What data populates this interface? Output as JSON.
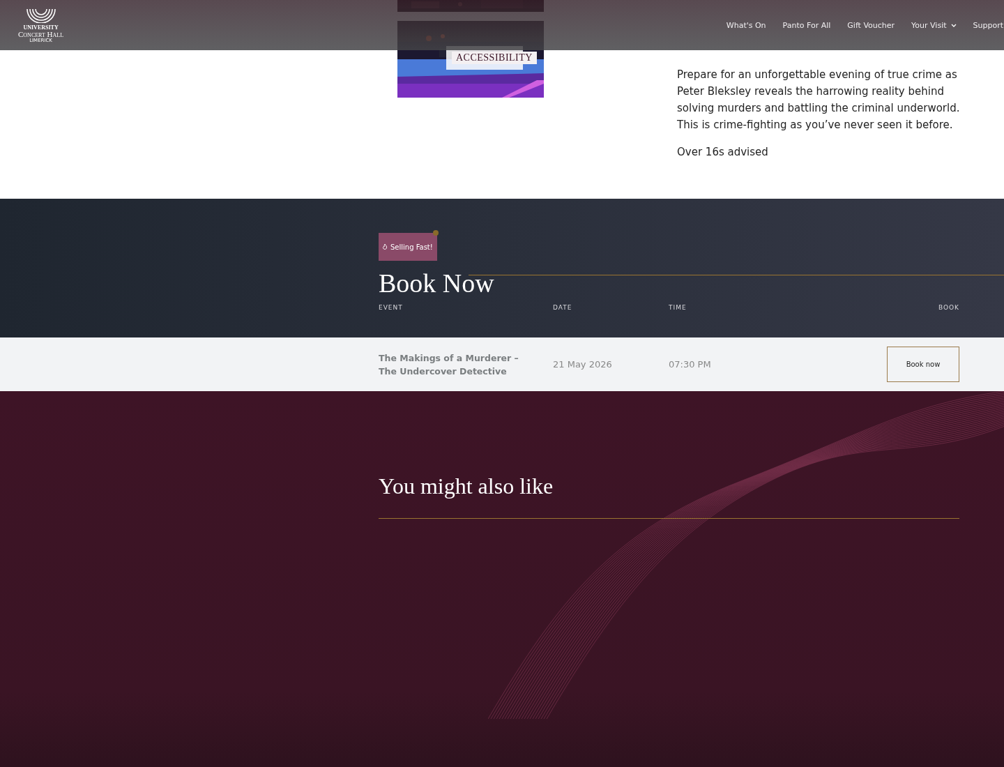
{
  "header": {
    "logo": {
      "line_1": "UNIVERSITY",
      "line_2": "Concert Hall",
      "line_3": "LIMERICK"
    },
    "nav": [
      {
        "label": "What's On",
        "dropdown": false
      },
      {
        "label": "Panto For All",
        "dropdown": false
      },
      {
        "label": "Gift Voucher",
        "dropdown": false
      },
      {
        "label": "Your Visit",
        "dropdown": true
      },
      {
        "label": "Support",
        "dropdown": false
      }
    ]
  },
  "banner": {
    "kind": "picture",
    "label": "ACCESSIBILITY"
  },
  "description": {
    "paragraphs": [
      "Prepare for an unforgettable evening of true crime as Peter Bleksley reveals the harrowing reality behind solving murders and battling the criminal underworld. This is crime-fighting as you’ve never seen it before.",
      "Over 16s advised"
    ]
  },
  "booking": {
    "badge": "Selling Fast!",
    "title": "Book Now",
    "columns": [
      "EVENT",
      "DATE",
      "TIME",
      "BOOK"
    ],
    "rows": [
      {
        "event": "The Makings of a Murderer – The Undercover Detective",
        "date": "21 May 2026",
        "time": "07:30 PM",
        "button": "Book now"
      }
    ]
  },
  "related": {
    "title": "You might also like"
  }
}
